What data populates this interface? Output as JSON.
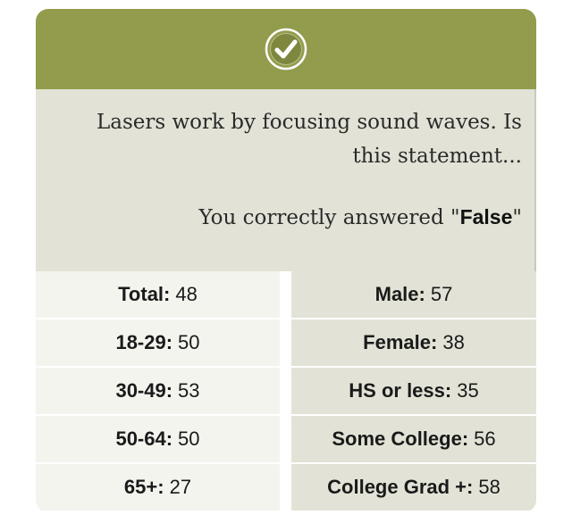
{
  "header": {
    "icon": "checkmark-circle-icon",
    "accent": "#939c4c"
  },
  "question": {
    "text": "Lasers work by focusing sound waves. Is this statement...",
    "answer_prefix": "You correctly answered \"",
    "answer_value": "False",
    "answer_suffix": "\""
  },
  "stats": {
    "left": [
      {
        "label": "Total:",
        "value": "48"
      },
      {
        "label": "18-29:",
        "value": "50"
      },
      {
        "label": "30-49:",
        "value": "53"
      },
      {
        "label": "50-64:",
        "value": "50"
      },
      {
        "label": "65+:",
        "value": "27"
      }
    ],
    "right": [
      {
        "label": "Male:",
        "value": "57"
      },
      {
        "label": "Female:",
        "value": "38"
      },
      {
        "label": "HS or less:",
        "value": "35"
      },
      {
        "label": "Some College:",
        "value": "56"
      },
      {
        "label": "College Grad +:",
        "value": "58"
      }
    ]
  }
}
